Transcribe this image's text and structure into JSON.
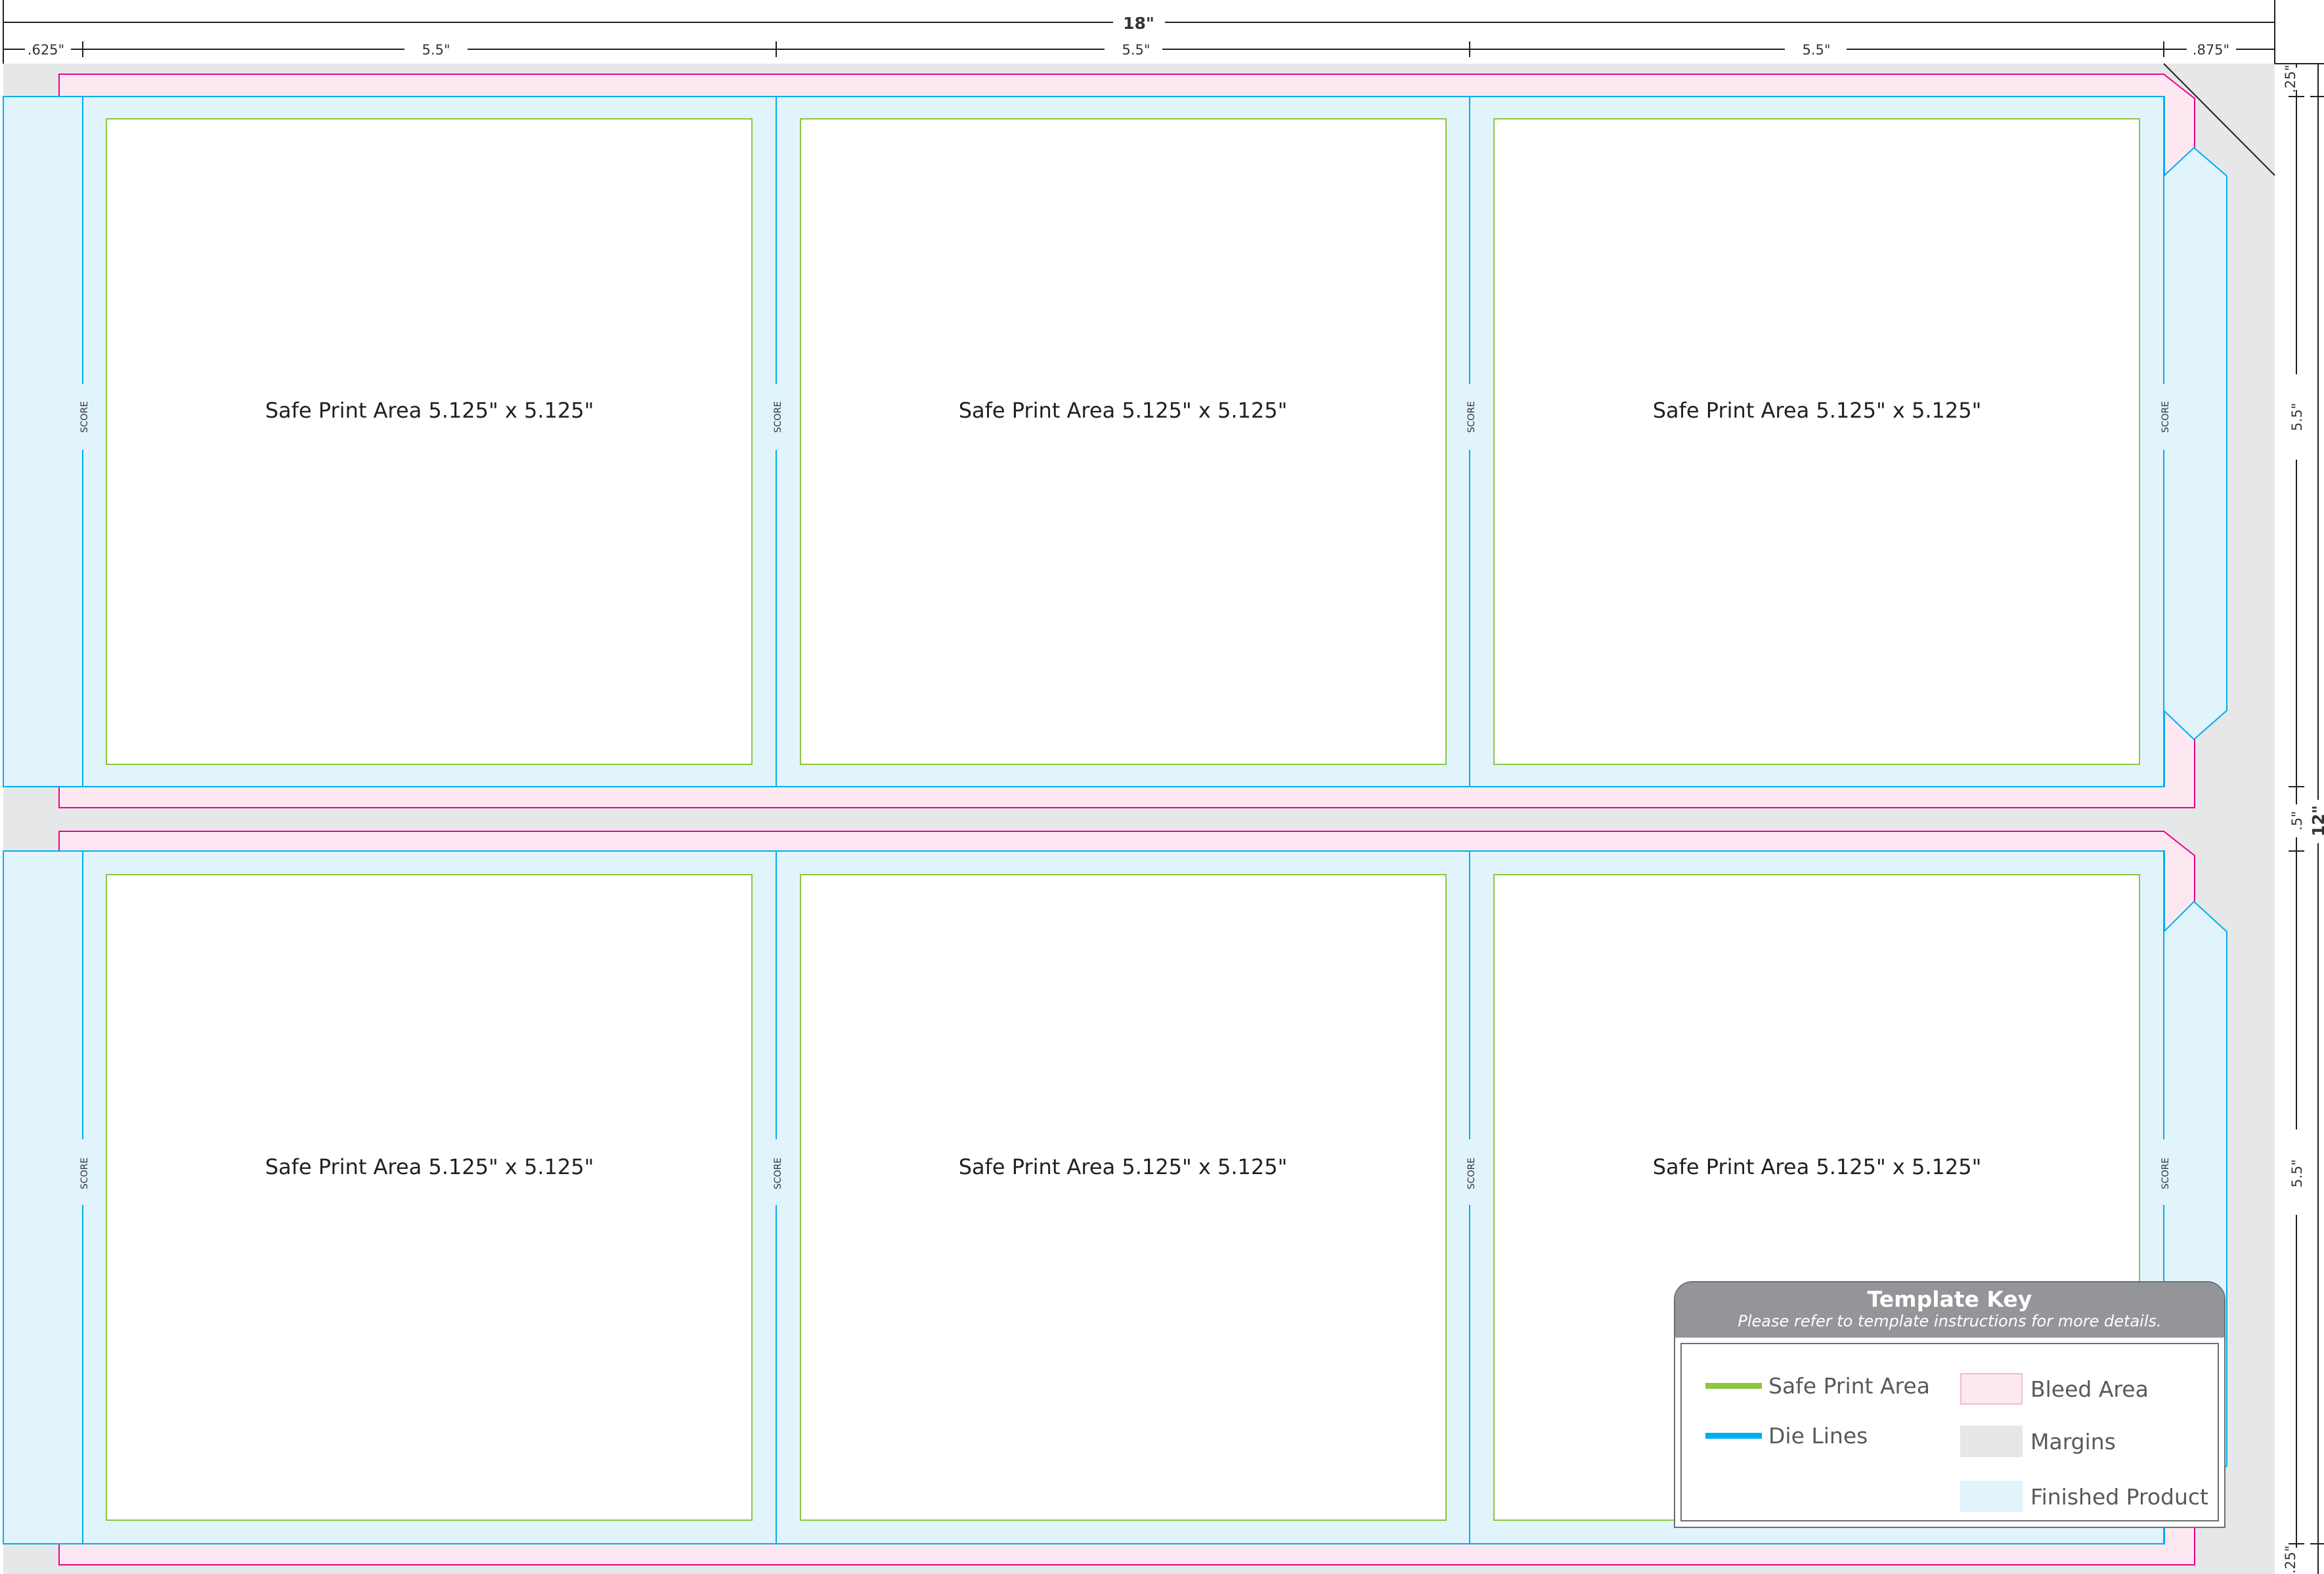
{
  "dimensions": {
    "overall_width": "18\"",
    "overall_height": "12\"",
    "left_margin": ".625\"",
    "panel_width": "5.5\"",
    "right_flap": ".875\"",
    "top_margin": ".25\"",
    "row_height": "5.5\"",
    "row_gap": ".5\"",
    "bottom_margin": ".25\""
  },
  "panels": {
    "safe_area_label": "Safe Print Area 5.125\" x 5.125\"",
    "score_label": "SCORE"
  },
  "key": {
    "title": "Template Key",
    "subtitle": "Please refer to template instructions for more details.",
    "items": {
      "safe": "Safe Print Area",
      "die": "Die Lines",
      "bleed": "Bleed Area",
      "margins": "Margins",
      "finished": "Finished Product"
    }
  },
  "colors": {
    "margins": "#e6e7e8",
    "bleed_fill": "#fde8f1",
    "bleed_line": "#ec008c",
    "finished": "#e1f3fb",
    "die_line": "#00aeef",
    "safe_line": "#8dc63f",
    "key_header": "#939598"
  }
}
